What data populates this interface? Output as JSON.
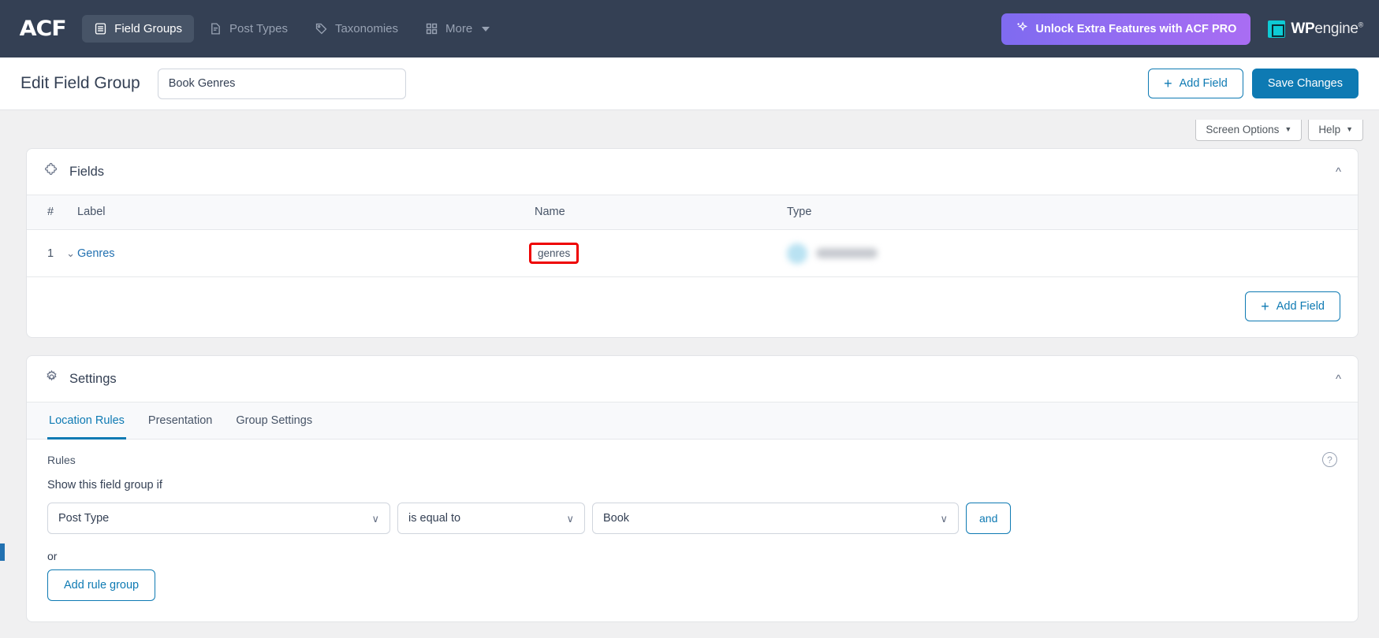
{
  "topbar": {
    "logo": "ACF",
    "nav": [
      {
        "label": "Field Groups",
        "icon": "list-document-icon",
        "active": true
      },
      {
        "label": "Post Types",
        "icon": "document-icon",
        "active": false
      },
      {
        "label": "Taxonomies",
        "icon": "tag-icon",
        "active": false
      },
      {
        "label": "More",
        "icon": "grid-icon",
        "active": false,
        "has_caret": true
      }
    ],
    "pro_button": {
      "label": "Unlock Extra Features with ACF PRO",
      "icon": "sparkle-icon"
    },
    "brand": {
      "bold": "WP",
      "light": "engine",
      "reg": "®"
    },
    "colors": {
      "bar_bg": "#344054",
      "active_bg": "#475467",
      "pro_from": "#7f6bf0",
      "pro_to": "#a96df3"
    }
  },
  "subheader": {
    "page_title": "Edit Field Group",
    "title_input_value": "Book Genres",
    "title_input_placeholder": "Add title",
    "add_field_label": "Add Field",
    "save_label": "Save Changes",
    "accent": "#0e7ab3"
  },
  "screen_meta": {
    "screen_options": "Screen Options",
    "help": "Help",
    "caret": "▼"
  },
  "fields_panel": {
    "title": "Fields",
    "icon": "puzzle-piece-icon",
    "collapse_icon": "chevron-up-icon",
    "columns": [
      "#",
      "Label",
      "Name",
      "Type"
    ],
    "rows": [
      {
        "num": "1",
        "label": "Genres",
        "name": "genres",
        "name_highlighted": true,
        "type": "",
        "type_blurred": true
      }
    ],
    "add_field_label": "Add Field",
    "highlight_color": "#ee0000"
  },
  "settings_panel": {
    "title": "Settings",
    "icon": "gear-icon",
    "collapse_icon": "chevron-up-icon",
    "tabs": [
      {
        "label": "Location Rules",
        "active": true
      },
      {
        "label": "Presentation",
        "active": false
      },
      {
        "label": "Group Settings",
        "active": false
      }
    ],
    "rules": {
      "heading": "Rules",
      "subheading": "Show this field group if",
      "help_icon": "question-mark-icon",
      "param_value": "Post Type",
      "operator_value": "is equal to",
      "value_value": "Book",
      "and_label": "and",
      "or_label": "or",
      "add_rule_group_label": "Add rule group",
      "chevron": "∨"
    }
  }
}
